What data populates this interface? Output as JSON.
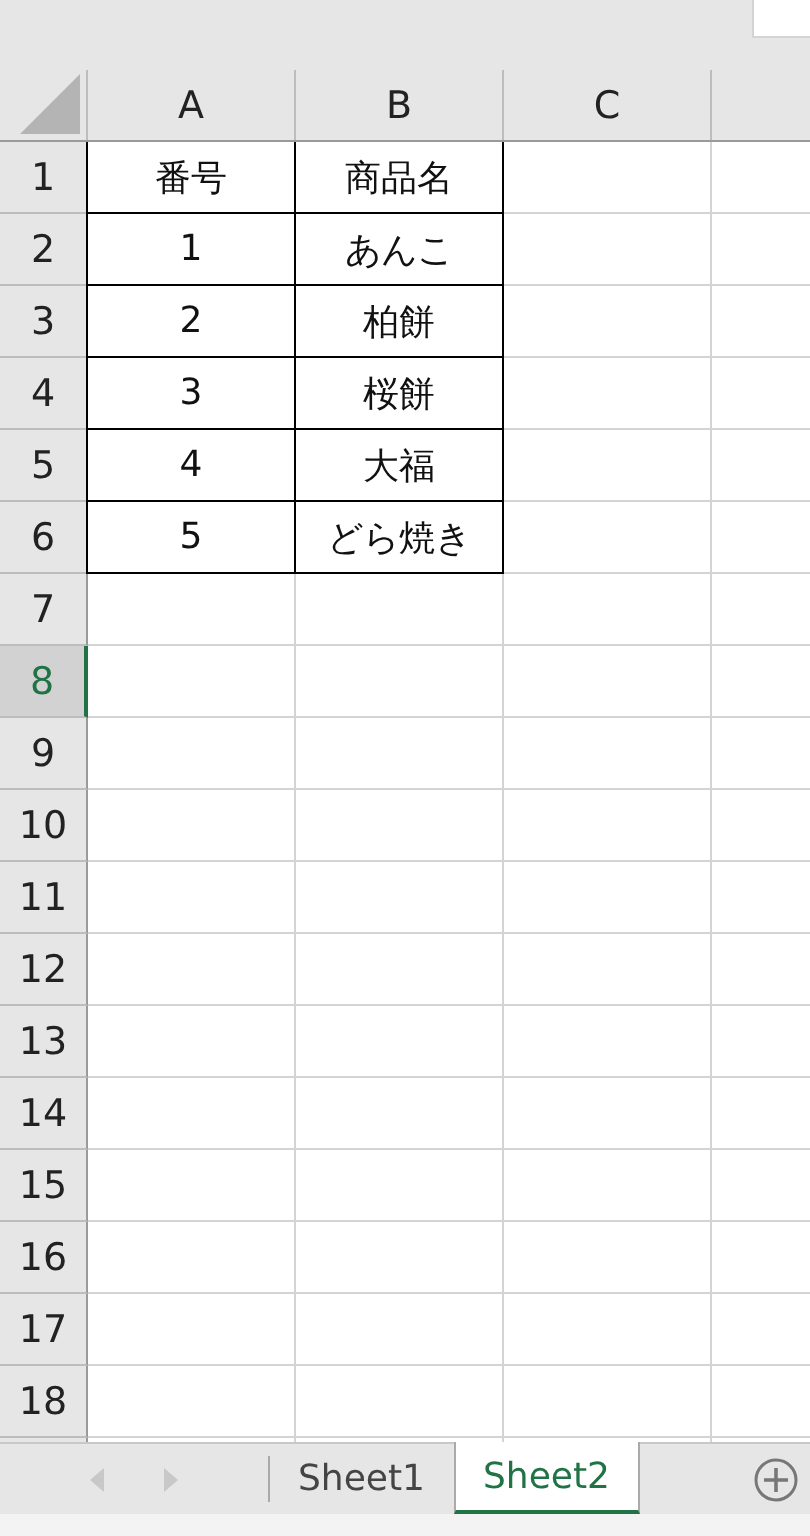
{
  "columns": [
    {
      "label": "A"
    },
    {
      "label": "B"
    },
    {
      "label": "C"
    }
  ],
  "rows": [
    {
      "label": "1",
      "selected": false,
      "cells": [
        "番号",
        "商品名"
      ]
    },
    {
      "label": "2",
      "selected": false,
      "cells": [
        "1",
        "あんこ"
      ]
    },
    {
      "label": "3",
      "selected": false,
      "cells": [
        "2",
        "柏餅"
      ]
    },
    {
      "label": "4",
      "selected": false,
      "cells": [
        "3",
        "桜餅"
      ]
    },
    {
      "label": "5",
      "selected": false,
      "cells": [
        "4",
        "大福"
      ]
    },
    {
      "label": "6",
      "selected": false,
      "cells": [
        "5",
        "どら焼き"
      ]
    },
    {
      "label": "7",
      "selected": false
    },
    {
      "label": "8",
      "selected": true
    },
    {
      "label": "9",
      "selected": false
    },
    {
      "label": "10",
      "selected": false
    },
    {
      "label": "11",
      "selected": false
    },
    {
      "label": "12",
      "selected": false
    },
    {
      "label": "13",
      "selected": false
    },
    {
      "label": "14",
      "selected": false
    },
    {
      "label": "15",
      "selected": false
    },
    {
      "label": "16",
      "selected": false
    },
    {
      "label": "17",
      "selected": false
    },
    {
      "label": "18",
      "selected": false
    }
  ],
  "sheet_tabs": [
    {
      "label": "Sheet1",
      "selected": false
    },
    {
      "label": "Sheet2",
      "selected": true
    }
  ]
}
